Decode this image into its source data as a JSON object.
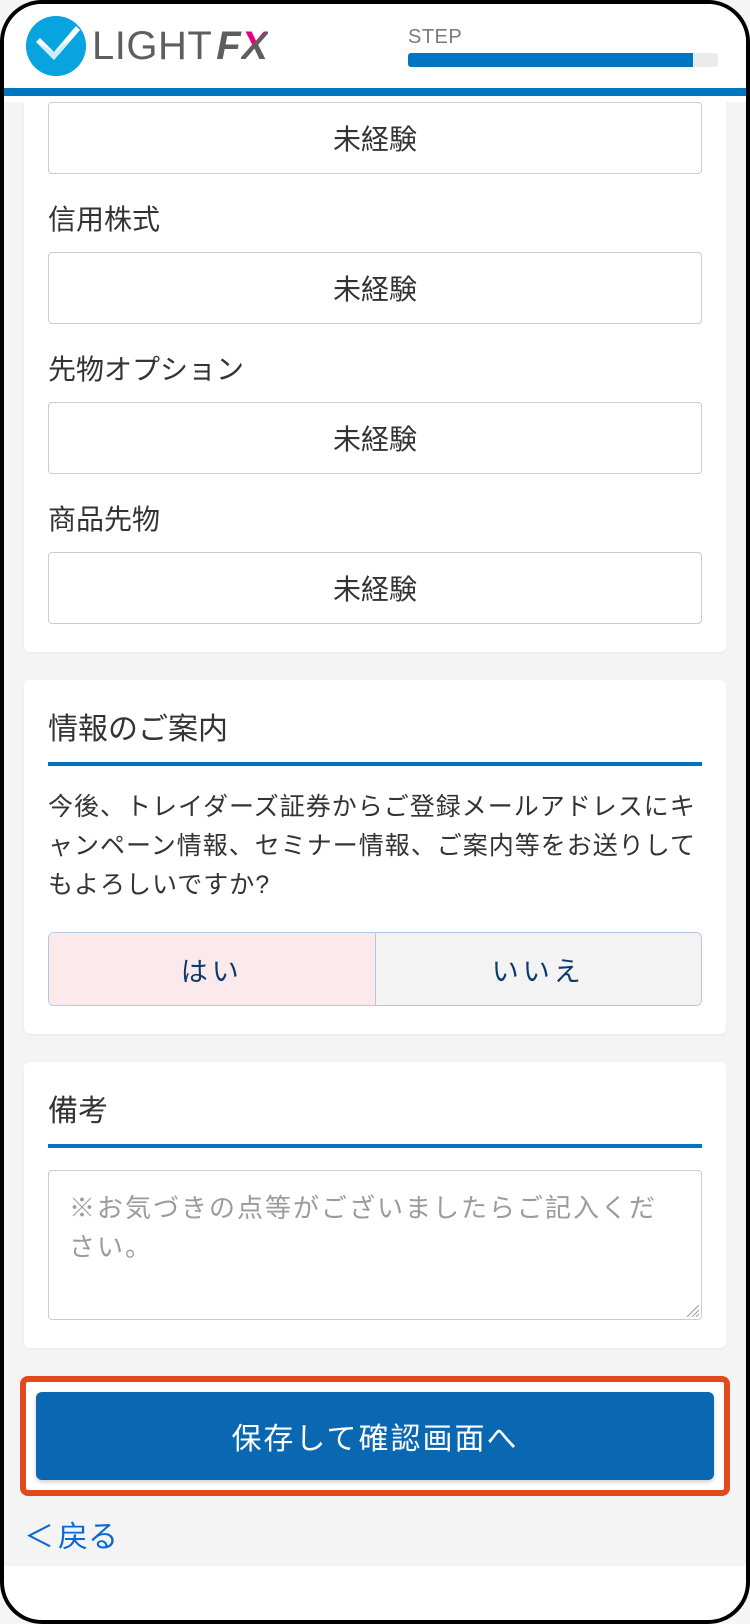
{
  "header": {
    "brand": "LIGHT",
    "brand_fx_f": "F",
    "brand_fx_x": "X",
    "progress_label": "STEP",
    "progress_percent": 92
  },
  "experience": {
    "top_value": "未経験",
    "items": [
      {
        "label": "信用株式",
        "value": "未経験"
      },
      {
        "label": "先物オプション",
        "value": "未経験"
      },
      {
        "label": "商品先物",
        "value": "未経験"
      }
    ]
  },
  "info": {
    "title": "情報のご案内",
    "text": "今後、トレイダーズ証券からご登録メールアドレスにキャンペーン情報、セミナー情報、ご案内等をお送りしてもよろしいですか?",
    "yes": "はい",
    "no": "いいえ",
    "selected": "yes"
  },
  "remarks": {
    "title": "備考",
    "placeholder": "※お気づきの点等がございましたらご記入ください。"
  },
  "actions": {
    "primary": "保存して確認画面へ",
    "back": "戻る"
  }
}
